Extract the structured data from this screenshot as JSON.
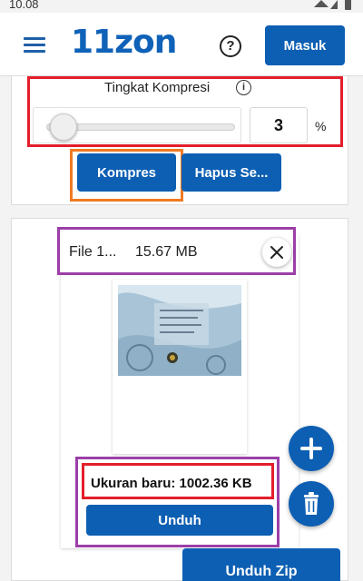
{
  "status_bar": {
    "time": "10.08"
  },
  "header": {
    "logo": "11zon",
    "login_label": "Masuk"
  },
  "compression": {
    "title": "Tingkat Kompresi",
    "level_value": "3",
    "unit": "%",
    "slider_fraction": 0.03,
    "compress_label": "Kompres",
    "clear_label": "Hapus Se..."
  },
  "file": {
    "name": "File 1...",
    "original_size": "15.67 MB",
    "new_size_text": "Ukuran baru: 1002.36 KB",
    "download_label": "Unduh"
  },
  "actions": {
    "zip_label": "Unduh Zip"
  },
  "icons": {
    "menu": "menu-icon",
    "help": "help-icon",
    "info": "info-icon",
    "close": "close-icon",
    "add": "plus-icon",
    "delete": "trash-icon"
  },
  "colors": {
    "primary": "#0d5fb3",
    "highlight_red": "#e31e2c",
    "highlight_orange": "#f07a22",
    "highlight_purple": "#9c3fa8"
  }
}
